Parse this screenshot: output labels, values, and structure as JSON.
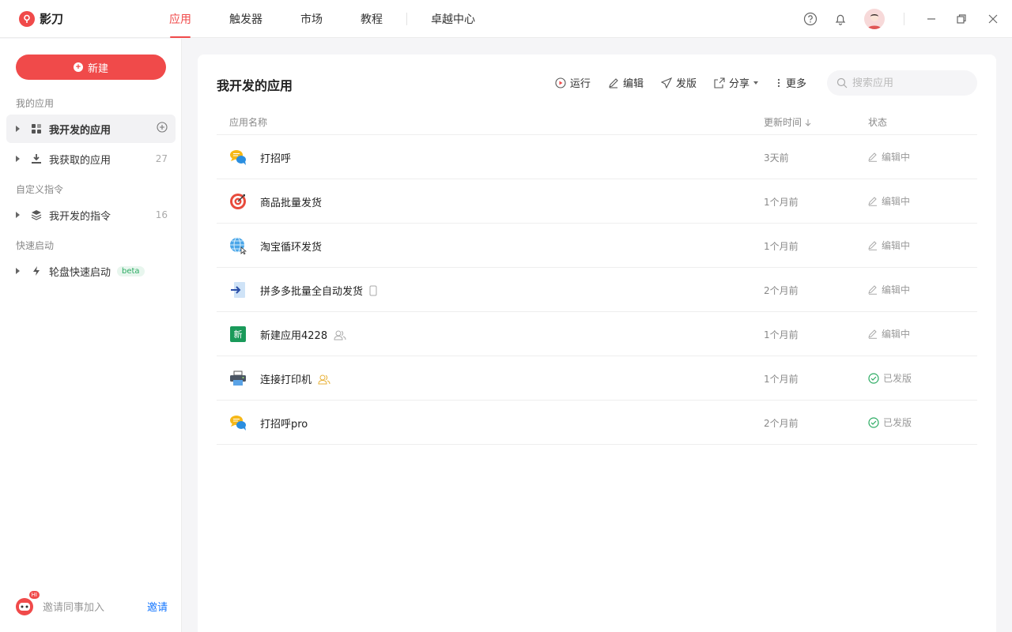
{
  "brand": {
    "name": "影刀"
  },
  "nav": {
    "tabs": [
      {
        "label": "应用",
        "active": true
      },
      {
        "label": "触发器"
      },
      {
        "label": "市场"
      },
      {
        "label": "教程"
      }
    ],
    "extra_tab": "卓越中心"
  },
  "window_controls": [
    "help-icon",
    "bell-icon",
    "avatar",
    "minimize-icon",
    "restore-icon",
    "close-icon"
  ],
  "sidebar": {
    "new_button": "新建",
    "sections": [
      {
        "title": "我的应用",
        "items": [
          {
            "label": "我开发的应用",
            "active": true,
            "icon": "grid-icon",
            "action": "add-icon"
          },
          {
            "label": "我获取的应用",
            "icon": "download-icon",
            "count": "27"
          }
        ]
      },
      {
        "title": "自定义指令",
        "items": [
          {
            "label": "我开发的指令",
            "icon": "layers-icon",
            "count": "16"
          }
        ]
      },
      {
        "title": "快速启动",
        "items": [
          {
            "label": "轮盘快速启动",
            "icon": "lightning-icon",
            "badge": "beta"
          }
        ]
      }
    ],
    "invite": {
      "badge": "HI",
      "text": "邀请同事加入",
      "link": "邀请"
    }
  },
  "main": {
    "title": "我开发的应用",
    "toolbar": {
      "run": "运行",
      "edit": "编辑",
      "publish": "发版",
      "share": "分享",
      "more": "更多"
    },
    "search_placeholder": "搜索应用",
    "columns": {
      "name": "应用名称",
      "time": "更新时间",
      "status": "状态"
    },
    "rows": [
      {
        "name": "打招呼",
        "icon": "chat-bubbles-icon",
        "time": "3天前",
        "status": "编辑中"
      },
      {
        "name": "商品批量发货",
        "icon": "target-icon",
        "time": "1个月前",
        "status": "编辑中"
      },
      {
        "name": "淘宝循环发货",
        "icon": "globe-icon",
        "time": "1个月前",
        "status": "编辑中"
      },
      {
        "name": "拼多多批量全自动发货",
        "icon": "arrow-in-icon",
        "time": "2个月前",
        "status": "编辑中",
        "tag": "mobile-icon"
      },
      {
        "name": "新建应用4228",
        "icon": "new-app-icon",
        "icon_text": "新",
        "time": "1个月前",
        "status": "编辑中",
        "tag": "user-group-icon"
      },
      {
        "name": "连接打印机",
        "icon": "printer-icon",
        "time": "1个月前",
        "status": "已发版",
        "tag": "user-group-icon"
      },
      {
        "name": "打招呼pro",
        "icon": "chat-bubbles-icon",
        "time": "2个月前",
        "status": "已发版"
      }
    ]
  },
  "colors": {
    "accent": "#f04a4a",
    "published": "#2bab62",
    "link": "#1677ff",
    "beta_bg": "#e8f6ee"
  }
}
